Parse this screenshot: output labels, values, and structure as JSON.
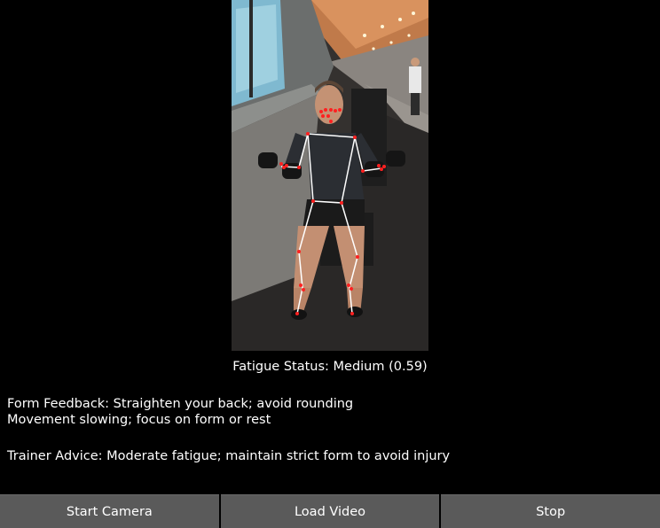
{
  "video": {
    "description_icon": "camera-feed-with-pose-overlay",
    "skeleton_color": "#ffffff",
    "keypoint_color": "#ff2020"
  },
  "status": {
    "fatigue": "Fatigue Status: Medium (0.59)"
  },
  "feedback": {
    "form_line1": "Form Feedback: Straighten your back; avoid rounding",
    "form_line2": "Movement slowing; focus on form or rest"
  },
  "advice": {
    "trainer": "Trainer Advice: Moderate fatigue; maintain strict form to avoid injury"
  },
  "buttons": {
    "start_camera": "Start Camera",
    "load_video": "Load Video",
    "stop": "Stop"
  },
  "colors": {
    "background": "#000000",
    "button": "#5a5a5a",
    "text": "#ffffff"
  }
}
